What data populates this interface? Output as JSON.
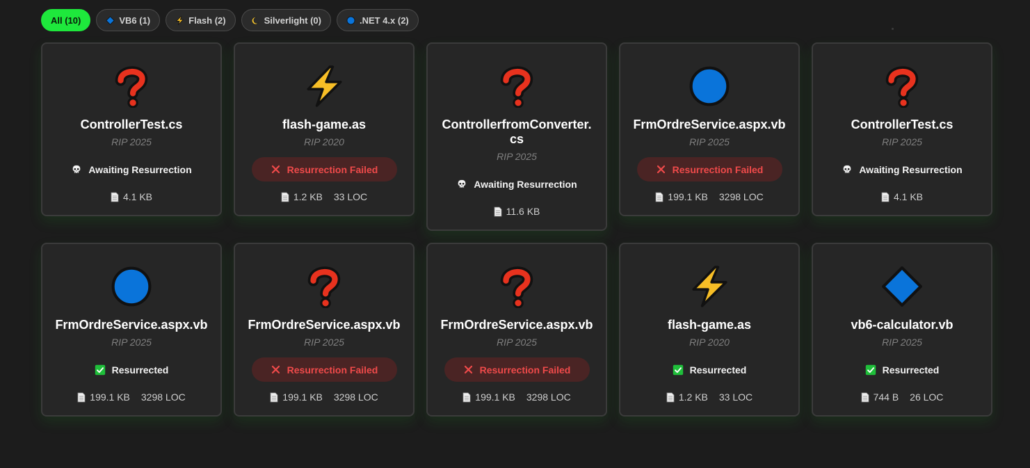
{
  "filters": [
    {
      "label": "All (10)",
      "icon": "",
      "active": true
    },
    {
      "label": "VB6 (1)",
      "icon": "diamond-icon",
      "active": false
    },
    {
      "label": "Flash (2)",
      "icon": "lightning-icon",
      "active": false
    },
    {
      "label": "Silverlight (0)",
      "icon": "moon-icon",
      "active": false
    },
    {
      "label": ".NET 4.x (2)",
      "icon": "blue-circle-icon",
      "active": false
    }
  ],
  "cards": [
    {
      "icon": "question-icon",
      "name": "ControllerTest.cs",
      "rip": "RIP 2025",
      "status": "awaiting",
      "status_label": "Awaiting Resurrection",
      "size": "4.1 KB",
      "loc": ""
    },
    {
      "icon": "lightning-icon",
      "name": "flash-game.as",
      "rip": "RIP 2020",
      "status": "failed",
      "status_label": "Resurrection Failed",
      "size": "1.2 KB",
      "loc": "33 LOC"
    },
    {
      "icon": "question-icon",
      "name": "ControllerfromConverter.cs",
      "rip": "RIP 2025",
      "status": "awaiting",
      "status_label": "Awaiting Resurrection",
      "size": "11.6 KB",
      "loc": ""
    },
    {
      "icon": "blue-circle-icon",
      "name": "FrmOrdreService.aspx.vb",
      "rip": "RIP 2025",
      "status": "failed",
      "status_label": "Resurrection Failed",
      "size": "199.1 KB",
      "loc": "3298 LOC"
    },
    {
      "icon": "question-icon",
      "name": "ControllerTest.cs",
      "rip": "RIP 2025",
      "status": "awaiting",
      "status_label": "Awaiting Resurrection",
      "size": "4.1 KB",
      "loc": ""
    },
    {
      "icon": "blue-circle-icon",
      "name": "FrmOrdreService.aspx.vb",
      "rip": "RIP 2025",
      "status": "resurrected",
      "status_label": "Resurrected",
      "size": "199.1 KB",
      "loc": "3298 LOC"
    },
    {
      "icon": "question-icon",
      "name": "FrmOrdreService.aspx.vb",
      "rip": "RIP 2025",
      "status": "failed",
      "status_label": "Resurrection Failed",
      "size": "199.1 KB",
      "loc": "3298 LOC"
    },
    {
      "icon": "question-icon",
      "name": "FrmOrdreService.aspx.vb",
      "rip": "RIP 2025",
      "status": "failed",
      "status_label": "Resurrection Failed",
      "size": "199.1 KB",
      "loc": "3298 LOC"
    },
    {
      "icon": "lightning-icon",
      "name": "flash-game.as",
      "rip": "RIP 2020",
      "status": "resurrected",
      "status_label": "Resurrected",
      "size": "1.2 KB",
      "loc": "33 LOC"
    },
    {
      "icon": "diamond-icon",
      "name": "vb6-calculator.vb",
      "rip": "RIP 2025",
      "status": "resurrected",
      "status_label": "Resurrected",
      "size": "744 B",
      "loc": "26 LOC"
    }
  ],
  "colors": {
    "accent": "#1ee83c",
    "failed_text": "#ef4a4a",
    "failed_bg": "#4a2424",
    "icon_blue": "#0a74da",
    "icon_red": "#e8321e",
    "icon_yellow": "#f7be26"
  }
}
